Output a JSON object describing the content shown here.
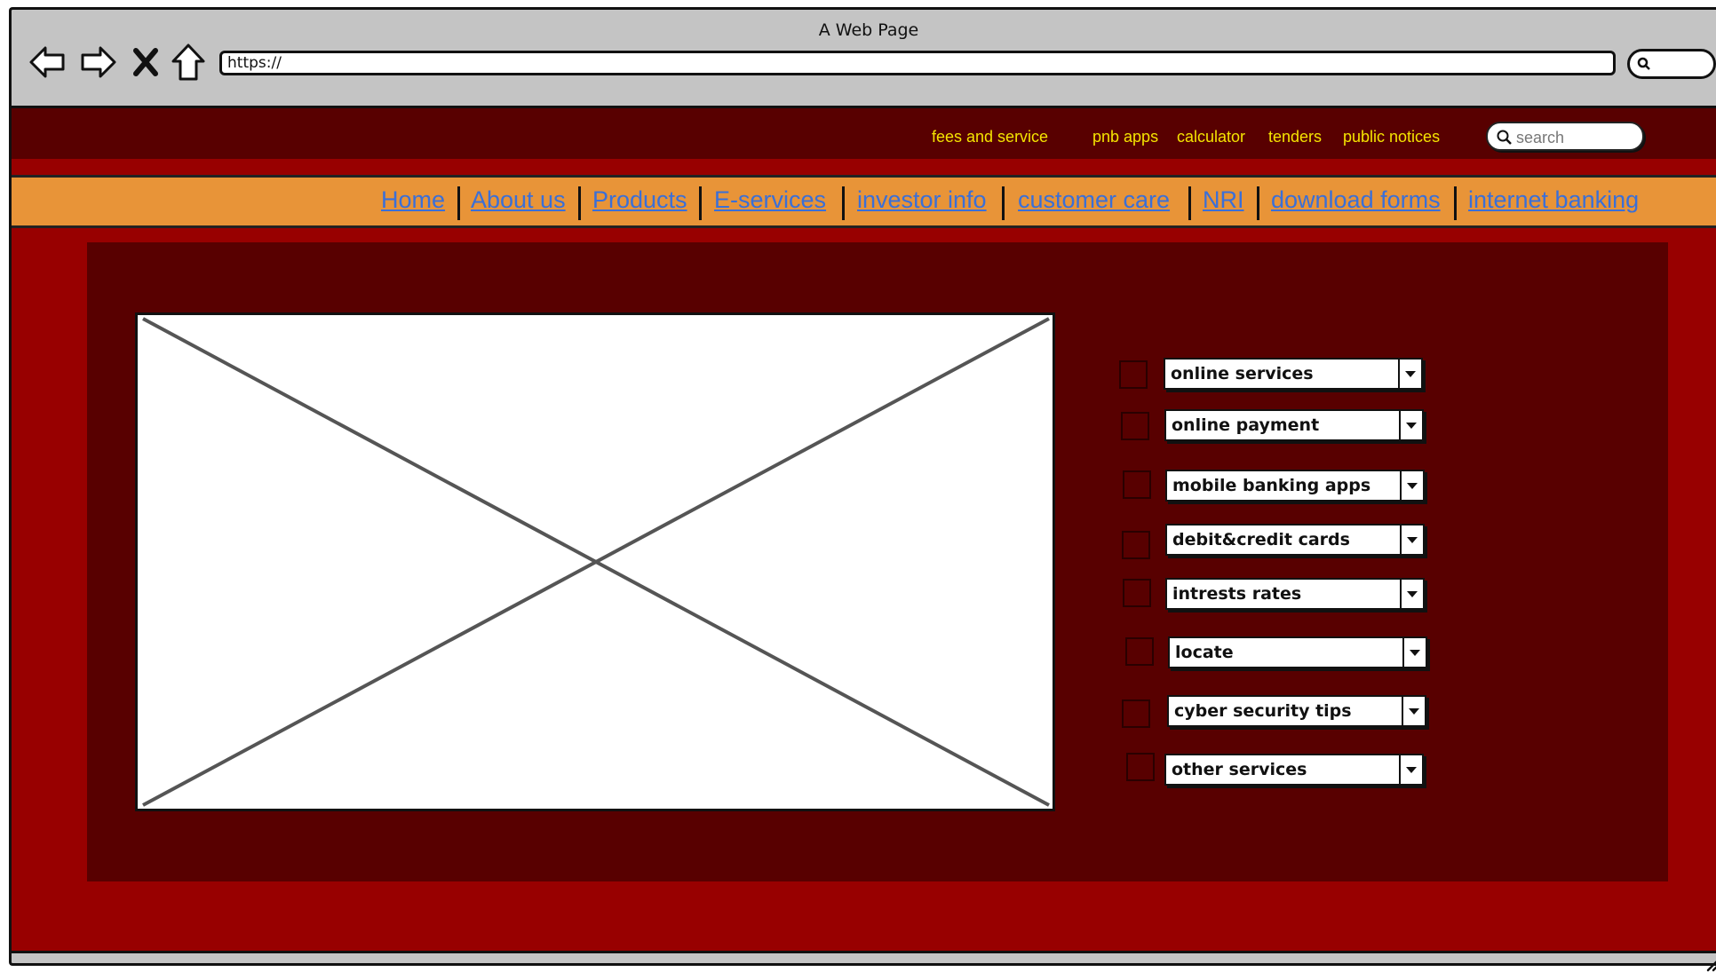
{
  "browser": {
    "title": "A Web Page",
    "url": "https://",
    "nav_icons": [
      "back-arrow-icon",
      "forward-arrow-icon",
      "close-x-icon",
      "home-icon"
    ]
  },
  "utility_links": [
    "fees and service",
    "pnb apps",
    "calculator",
    "tenders",
    "public notices"
  ],
  "site_search": {
    "placeholder": "search",
    "icon": "search-icon"
  },
  "main_nav": [
    "Home",
    "About us",
    "Products",
    "E-services",
    "investor info",
    "customer care",
    "NRI",
    "download forms",
    "internet banking"
  ],
  "hero_image": {
    "icon": "image-placeholder-icon"
  },
  "services": [
    {
      "label": "online services"
    },
    {
      "label": "online payment"
    },
    {
      "label": "mobile banking apps"
    },
    {
      "label": "debit&credit cards"
    },
    {
      "label": "intrests rates"
    },
    {
      "label": "locate"
    },
    {
      "label": "cyber security tips"
    },
    {
      "label": "other services"
    }
  ],
  "colors": {
    "dark_maroon": "#580000",
    "red": "#980000",
    "orange_nav": "#e89438",
    "link_blue": "#3a6fd8",
    "utility_yellow": "#f5e400",
    "chrome_gray": "#c4c4c4"
  }
}
